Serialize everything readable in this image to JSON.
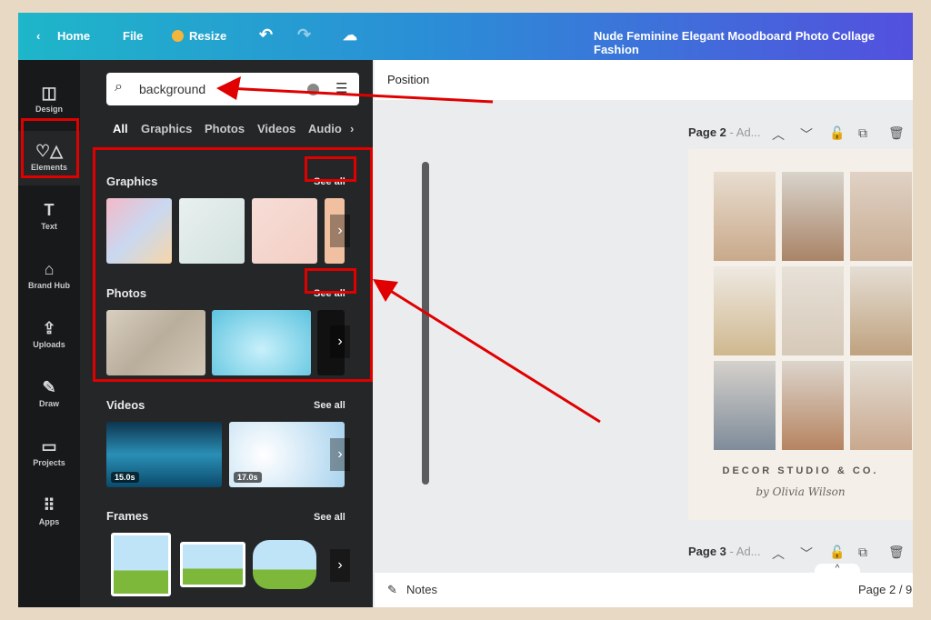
{
  "topbar": {
    "home": "Home",
    "file": "File",
    "resize": "Resize",
    "title": "Nude Feminine Elegant Moodboard Photo Collage Fashion"
  },
  "rail": [
    {
      "label": "Design",
      "icon": "layout-icon"
    },
    {
      "label": "Elements",
      "icon": "shapes-icon"
    },
    {
      "label": "Text",
      "icon": "text-icon"
    },
    {
      "label": "Brand Hub",
      "icon": "brand-icon"
    },
    {
      "label": "Uploads",
      "icon": "upload-icon"
    },
    {
      "label": "Draw",
      "icon": "draw-icon"
    },
    {
      "label": "Projects",
      "icon": "folder-icon"
    },
    {
      "label": "Apps",
      "icon": "apps-icon"
    }
  ],
  "search": {
    "value": "background"
  },
  "tabs": [
    "All",
    "Graphics",
    "Photos",
    "Videos",
    "Audio"
  ],
  "sections": {
    "graphics": "Graphics",
    "photos": "Photos",
    "videos": "Videos",
    "frames": "Frames",
    "see_all": "See all"
  },
  "videos": {
    "d1": "15.0s",
    "d2": "17.0s"
  },
  "canvas": {
    "position": "Position",
    "page2": "Page 2",
    "page3": "Page 3",
    "ad": "- Ad...",
    "brand": "DECOR STUDIO & CO.",
    "signature": "by Olivia Wilson",
    "notes": "Notes",
    "page_count": "Page 2 / 9"
  },
  "colors": {
    "annotation": "#e00000",
    "rail": "#18191b",
    "panel": "#252627"
  }
}
